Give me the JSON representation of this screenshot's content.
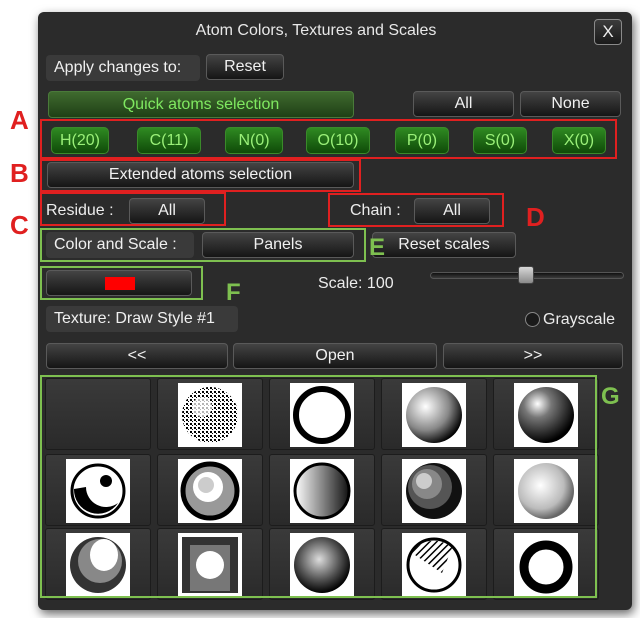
{
  "window": {
    "title": "Atom Colors, Textures and Scales",
    "close_label": "X"
  },
  "apply": {
    "label": "Apply changes to:",
    "reset_label": "Reset"
  },
  "quick_selection": {
    "label": "Quick atoms selection",
    "all_label": "All",
    "none_label": "None"
  },
  "elements": [
    "H(20)",
    "C(11)",
    "N(0)",
    "O(10)",
    "P(0)",
    "S(0)",
    "X(0)"
  ],
  "extended_selection": {
    "label": "Extended atoms selection"
  },
  "residue": {
    "label": "Residue :",
    "value": "All"
  },
  "chain": {
    "label": "Chain :",
    "value": "All"
  },
  "color_scale": {
    "label": "Color and Scale :",
    "panels_label": "Panels",
    "reset_scales_label": "Reset scales"
  },
  "color_swatch": {
    "color": "#ff0000"
  },
  "scale": {
    "label": "Scale: 100",
    "value": 100
  },
  "texture": {
    "label": "Texture: Draw Style #1",
    "grayscale_label": "Grayscale"
  },
  "navigation": {
    "prev_label": "<<",
    "open_label": "Open",
    "next_label": ">>"
  },
  "annotations": {
    "A": "A",
    "B": "B",
    "C": "C",
    "D": "D",
    "E": "E",
    "F": "F",
    "G": "G"
  },
  "texture_tiles": [
    "empty",
    "noise-sphere",
    "ring-sphere",
    "stipple-sphere",
    "dark-stipple-sphere",
    "shadow-sphere",
    "gray-ring-sphere",
    "gradient-sphere",
    "banded-sphere",
    "light-stipple-sphere",
    "highlight-sphere",
    "cutout-sphere",
    "dotted-sphere",
    "hatched-sphere",
    "brush-ring-sphere"
  ],
  "colors": {
    "annotation_red": "#e02020",
    "annotation_green": "#7ec050",
    "element_green": "#2f8a22"
  }
}
